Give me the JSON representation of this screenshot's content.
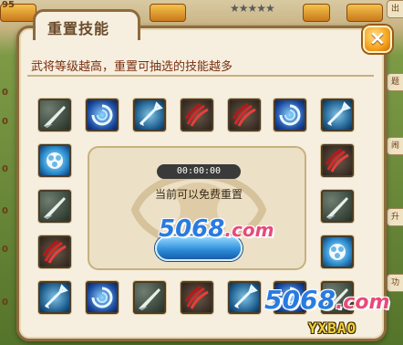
{
  "background": {
    "left_numbers": [
      "95",
      "0",
      "0",
      "0",
      "0",
      "0",
      "0"
    ],
    "right_tabs": [
      "出",
      "题",
      "闹",
      "升",
      "功"
    ]
  },
  "dialog": {
    "title": "重置技能",
    "description": "武将等级越高，重置可抽选的技能越多",
    "close_label": "×"
  },
  "skills": {
    "top_row": [
      "blade-skill-icon",
      "swirl-skill-icon",
      "arrow-skill-icon",
      "claw-skill-icon",
      "claw-skill-icon",
      "swirl-skill-icon",
      "arrow-skill-icon"
    ],
    "left_column": [
      "shield-skill-icon",
      "blade-skill-icon",
      "claw-skill-icon"
    ],
    "right_column": [
      "claw-skill-icon",
      "blade-skill-icon",
      "shield-skill-icon"
    ],
    "bottom_row": [
      "arrow-skill-icon",
      "swirl-skill-icon",
      "blade-skill-icon",
      "claw-skill-icon",
      "arrow-skill-icon",
      "swirl-skill-icon",
      "blade-skill-icon"
    ]
  },
  "reset_panel": {
    "timer": "00:00:00",
    "status": "当前可以免费重置"
  },
  "watermarks": {
    "site_a_number": "5068",
    "site_a_tld": ".com",
    "site_b_number": "5068",
    "site_b_tld": ".com",
    "brand": "YXBAO"
  },
  "colors": {
    "dialog_bg": "#f6efdf",
    "dialog_border": "#8d6a3d",
    "description_text": "#7a2f10",
    "button_blue": "#2a8ad8",
    "close_orange": "#f6a21c"
  }
}
